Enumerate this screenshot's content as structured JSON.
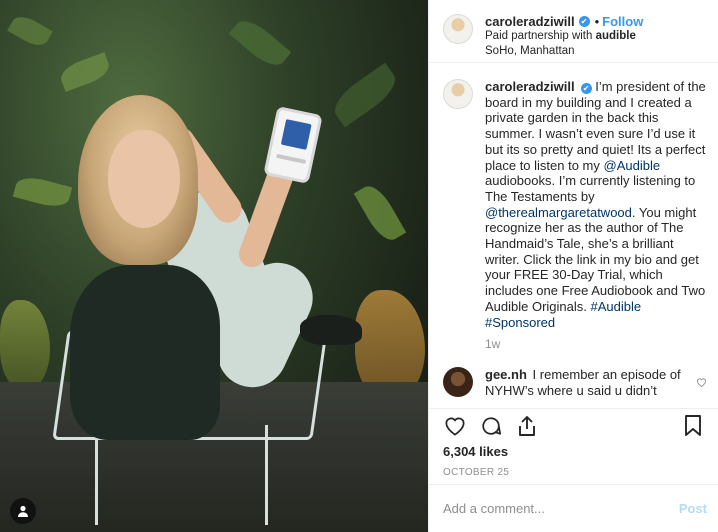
{
  "post": {
    "username": "caroleradziwill",
    "follow_label": "Follow",
    "dot": "•",
    "verified_icon": "✔",
    "partnership_prefix": "Paid partnership with",
    "partner": "audible",
    "location": "SoHo, Manhattan"
  },
  "caption": {
    "username": "caroleradziwill",
    "text_1": "I’m president of the board in my building and I created a private garden in the back this summer. I wasn’t even sure I’d use it but its so pretty and quiet! Its a perfect place to listen to my",
    "mention_audible": "@Audible",
    "text_2": "audiobooks. I’m currently listening to The Testaments by",
    "mention_author": "@therealmargaretatwood",
    "text_3": ". You might recognize her as the author of The Handmaid’s Tale, she’s a brilliant writer. Click the link in my bio and get your FREE 30-Day Trial, which includes one Free Audiobook and Two Audible Originals.",
    "hashtag_audible": "#Audible",
    "hashtag_sponsored": "#Sponsored",
    "time": "1w"
  },
  "comment": {
    "username": "gee.nh",
    "text": "I remember an episode of NYHW’s where u said u didn’t"
  },
  "actions": {
    "likes": "6,304 likes",
    "date": "OCTOBER 25"
  },
  "add_comment": {
    "placeholder": "Add a comment...",
    "post_label": "Post"
  },
  "icons": {
    "like": "heart-icon",
    "comment": "comment-icon",
    "share": "share-icon",
    "save": "bookmark-icon",
    "tag": "user-tag-icon"
  },
  "colors": {
    "link": "#003569",
    "follow": "#3897f0",
    "post_disabled": "#b3dbff"
  }
}
